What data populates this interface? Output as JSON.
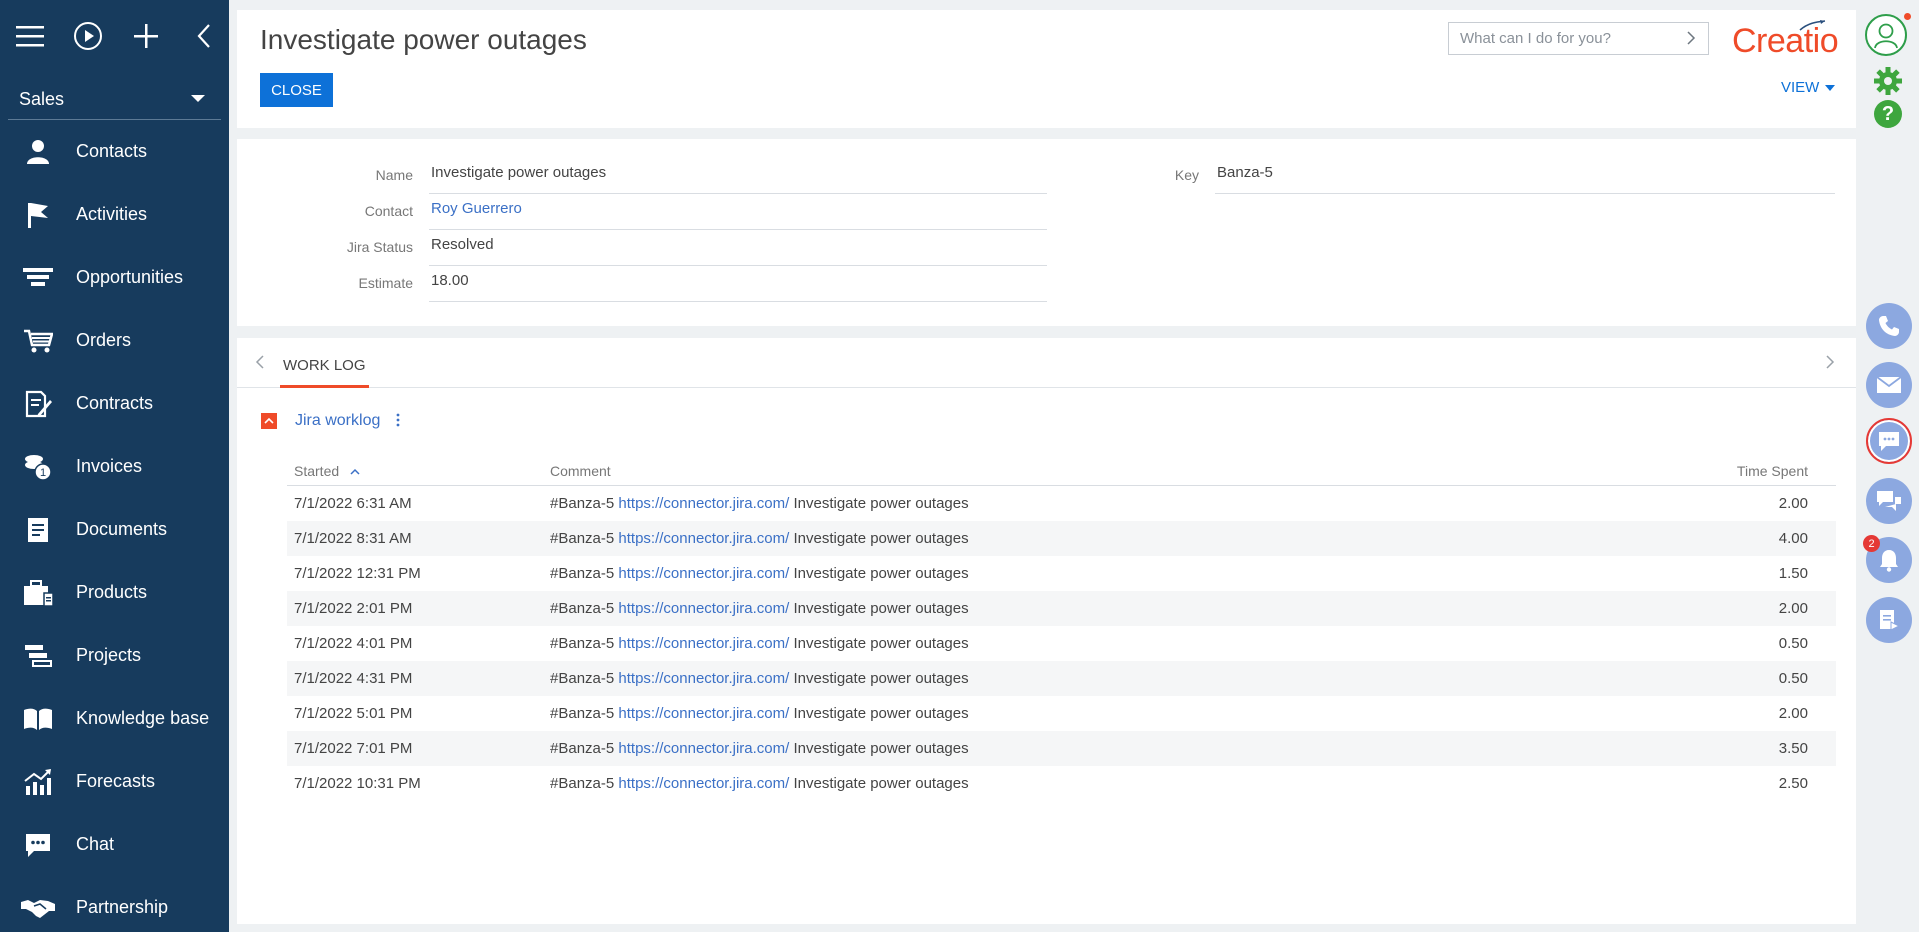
{
  "app": {
    "workspace": "Sales",
    "logo_text": "Creatio",
    "brand_color": "#ef4b29",
    "sidebar_color": "#173b5d",
    "accent_color": "#0d71d8"
  },
  "sidebar": {
    "top_icons": [
      "menu-icon",
      "play-icon",
      "plus-icon",
      "chevron-left-icon"
    ],
    "items": [
      {
        "label": "Contacts",
        "icon": "person-icon"
      },
      {
        "label": "Activities",
        "icon": "flag-icon"
      },
      {
        "label": "Opportunities",
        "icon": "funnel-icon"
      },
      {
        "label": "Orders",
        "icon": "cart-icon"
      },
      {
        "label": "Contracts",
        "icon": "contract-icon"
      },
      {
        "label": "Invoices",
        "icon": "coins-icon"
      },
      {
        "label": "Documents",
        "icon": "document-icon"
      },
      {
        "label": "Products",
        "icon": "box-icon"
      },
      {
        "label": "Projects",
        "icon": "projects-icon"
      },
      {
        "label": "Knowledge base",
        "icon": "book-icon"
      },
      {
        "label": "Forecasts",
        "icon": "chart-icon"
      },
      {
        "label": "Chat",
        "icon": "chat-icon"
      },
      {
        "label": "Partnership",
        "icon": "handshake-icon"
      }
    ]
  },
  "header": {
    "title": "Investigate power outages",
    "close_label": "CLOSE",
    "search_placeholder": "What can I do for you?",
    "view_label": "VIEW"
  },
  "details": {
    "name": {
      "label": "Name",
      "value": "Investigate power outages"
    },
    "contact": {
      "label": "Contact",
      "value": "Roy Guerrero"
    },
    "jira_status": {
      "label": "Jira Status",
      "value": "Resolved"
    },
    "estimate": {
      "label": "Estimate",
      "value": "18.00"
    },
    "key": {
      "label": "Key",
      "value": "Banza-5"
    }
  },
  "tabs": [
    {
      "label": "WORK LOG",
      "active": true
    }
  ],
  "worklog": {
    "title": "Jira worklog",
    "columns": {
      "started": "Started",
      "comment": "Comment",
      "time_spent": "Time Spent"
    },
    "rows": [
      {
        "started": "7/1/2022 6:31 AM",
        "prefix": "#Banza-5",
        "url": "https://connector.jira.com/",
        "suffix": "Investigate power outages",
        "time": "2.00"
      },
      {
        "started": "7/1/2022 8:31 AM",
        "prefix": "#Banza-5",
        "url": "https://connector.jira.com/",
        "suffix": "Investigate power outages",
        "time": "4.00"
      },
      {
        "started": "7/1/2022 12:31 PM",
        "prefix": "#Banza-5",
        "url": "https://connector.jira.com/",
        "suffix": "Investigate power outages",
        "time": "1.50"
      },
      {
        "started": "7/1/2022 2:01 PM",
        "prefix": "#Banza-5",
        "url": "https://connector.jira.com/",
        "suffix": "Investigate power outages",
        "time": "2.00"
      },
      {
        "started": "7/1/2022 4:01 PM",
        "prefix": "#Banza-5",
        "url": "https://connector.jira.com/",
        "suffix": "Investigate power outages",
        "time": "0.50"
      },
      {
        "started": "7/1/2022 4:31 PM",
        "prefix": "#Banza-5",
        "url": "https://connector.jira.com/",
        "suffix": "Investigate power outages",
        "time": "0.50"
      },
      {
        "started": "7/1/2022 5:01 PM",
        "prefix": "#Banza-5",
        "url": "https://connector.jira.com/",
        "suffix": "Investigate power outages",
        "time": "2.00"
      },
      {
        "started": "7/1/2022 7:01 PM",
        "prefix": "#Banza-5",
        "url": "https://connector.jira.com/",
        "suffix": "Investigate power outages",
        "time": "3.50"
      },
      {
        "started": "7/1/2022 10:31 PM",
        "prefix": "#Banza-5",
        "url": "https://connector.jira.com/",
        "suffix": "Investigate power outages",
        "time": "2.50"
      }
    ]
  },
  "rail": {
    "notification_count": "2",
    "buttons": [
      "phone-icon",
      "email-icon",
      "chat-bubble-icon",
      "feed-icon",
      "bell-icon",
      "process-icon"
    ]
  }
}
